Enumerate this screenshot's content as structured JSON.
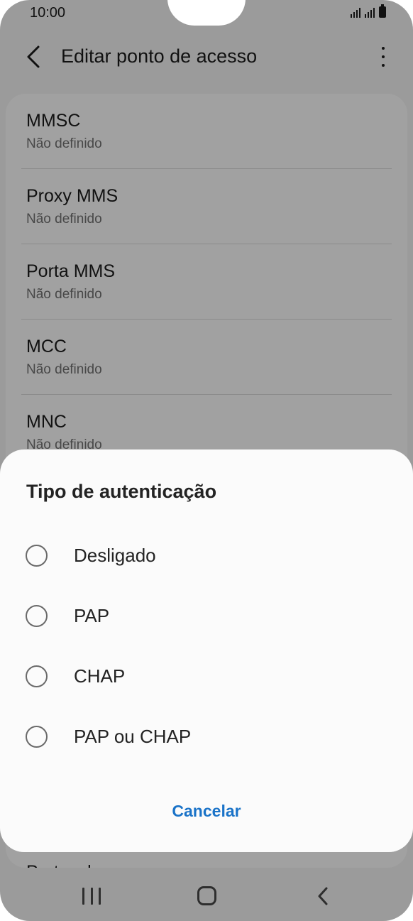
{
  "status_bar": {
    "time": "10:00"
  },
  "header": {
    "title": "Editar ponto de acesso",
    "back_icon": "chevron-left-icon",
    "more_icon": "more-vert-icon"
  },
  "settings": [
    {
      "title": "MMSC",
      "value": "Não definido"
    },
    {
      "title": "Proxy MMS",
      "value": "Não definido"
    },
    {
      "title": "Porta MMS",
      "value": "Não definido"
    },
    {
      "title": "MCC",
      "value": "Não definido"
    },
    {
      "title": "MNC",
      "value": "Não definido"
    }
  ],
  "partial_item": "Protocolo",
  "dialog": {
    "title": "Tipo de autenticação",
    "options": [
      "Desligado",
      "PAP",
      "CHAP",
      "PAP ou CHAP"
    ],
    "cancel_label": "Cancelar"
  },
  "colors": {
    "accent": "#1a73c8",
    "overlay": "rgba(0,0,0,0.37)"
  }
}
